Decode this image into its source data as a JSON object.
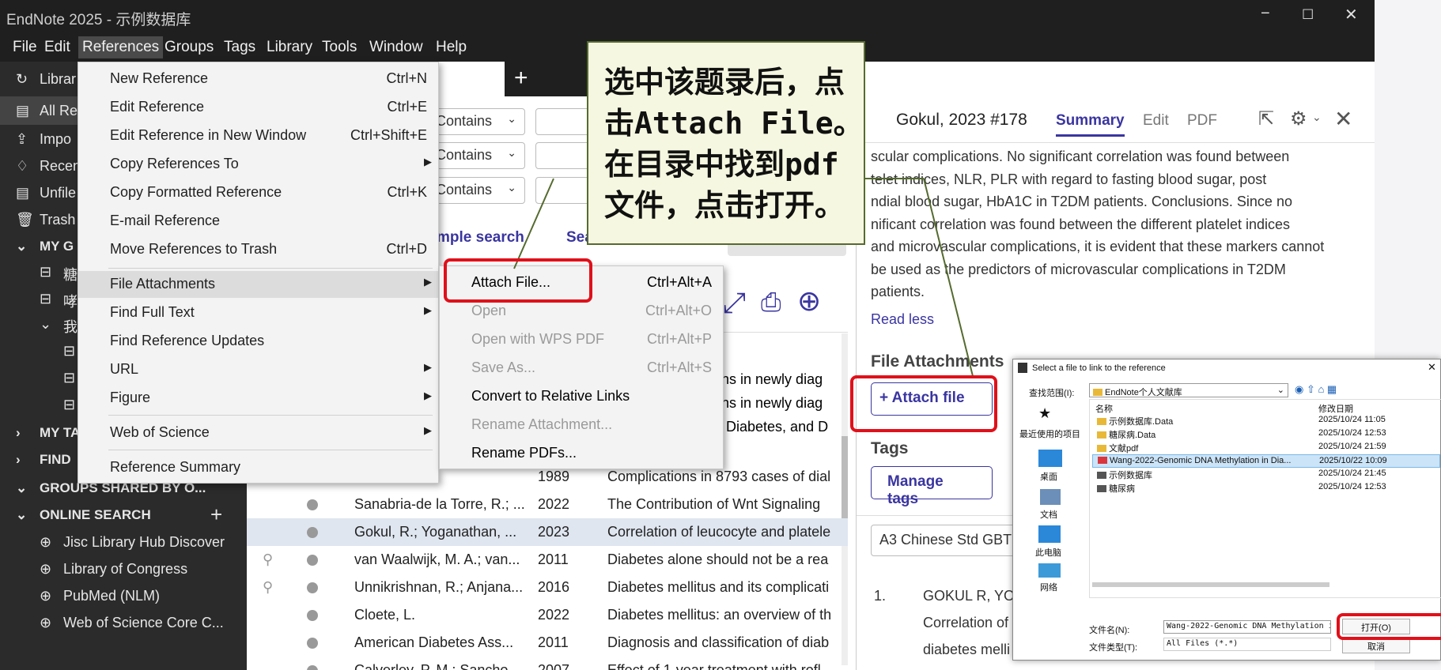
{
  "window": {
    "title": "EndNote 2025 - 示例数据库",
    "min": "−",
    "max": "☐",
    "close": "✕"
  },
  "menubar": [
    "File",
    "Edit",
    "References",
    "Groups",
    "Tags",
    "Library",
    "Tools",
    "Window",
    "Help"
  ],
  "sidebar": {
    "items": [
      "Librar",
      "All Re",
      "Impo",
      "Recen",
      "Unfile",
      "Trash",
      "MY G",
      "糖",
      "哮",
      "我",
      "MY TA",
      "FIND",
      "GROUPS SHARED BY O...",
      "ONLINE SEARCH",
      "Jisc Library Hub Discover",
      "Library of Congress",
      "PubMed (NLM)",
      "Web of Science Core C..."
    ]
  },
  "search": {
    "contains": "Contains",
    "simple": "mple search",
    "sea": "Sea"
  },
  "references_menu": [
    {
      "label": "New Reference",
      "shortcut": "Ctrl+N"
    },
    {
      "label": "Edit Reference",
      "shortcut": "Ctrl+E"
    },
    {
      "label": "Edit Reference in New Window",
      "shortcut": "Ctrl+Shift+E"
    },
    {
      "label": "Copy References To",
      "shortcut": ""
    },
    {
      "label": "Copy Formatted Reference",
      "shortcut": "Ctrl+K"
    },
    {
      "label": "E-mail Reference",
      "shortcut": ""
    },
    {
      "label": "Move References to Trash",
      "shortcut": "Ctrl+D"
    },
    {
      "label": "File Attachments",
      "shortcut": ""
    },
    {
      "label": "Find Full Text",
      "shortcut": ""
    },
    {
      "label": "Find Reference Updates",
      "shortcut": ""
    },
    {
      "label": "URL",
      "shortcut": ""
    },
    {
      "label": "Figure",
      "shortcut": ""
    },
    {
      "label": "Web of Science",
      "shortcut": ""
    },
    {
      "label": "Reference Summary",
      "shortcut": ""
    }
  ],
  "file_submenu": [
    {
      "label": "Attach File...",
      "shortcut": "Ctrl+Alt+A"
    },
    {
      "label": "Open",
      "shortcut": "Ctrl+Alt+O"
    },
    {
      "label": "Open with WPS PDF",
      "shortcut": "Ctrl+Alt+P"
    },
    {
      "label": "Save As...",
      "shortcut": "Ctrl+Alt+S"
    },
    {
      "label": "Convert to Relative Links",
      "shortcut": ""
    },
    {
      "label": "Rename Attachment...",
      "shortcut": ""
    },
    {
      "label": "Rename PDFs...",
      "shortcut": ""
    }
  ],
  "callout": [
    "选中该题录后，点",
    "击Attach File。",
    "在目录中找到pdf",
    "文件，点击打开。"
  ],
  "table": {
    "partial": [
      "ions in newly diag",
      "ions in newly diag",
      "g, Diabetes, and D"
    ],
    "rows": [
      {
        "author": "",
        "year": "1989",
        "title": "Complications in 8793 cases of dial"
      },
      {
        "author": "Sanabria-de la Torre, R.; ...",
        "year": "2022",
        "title": "The Contribution of Wnt Signaling"
      },
      {
        "author": "Gokul, R.; Yoganathan, ...",
        "year": "2023",
        "title": "Correlation of leucocyte and platele"
      },
      {
        "author": "van Waalwijk, M. A.; van...",
        "year": "2011",
        "title": "Diabetes alone should not be a rea"
      },
      {
        "author": "Unnikrishnan, R.; Anjana...",
        "year": "2016",
        "title": "Diabetes mellitus and its complicati"
      },
      {
        "author": "Cloete, L.",
        "year": "2022",
        "title": "Diabetes mellitus: an overview of th"
      },
      {
        "author": "American Diabetes Ass...",
        "year": "2011",
        "title": "Diagnosis and classification of diab"
      },
      {
        "author": "Calverley, P. M.; Sancho...",
        "year": "2007",
        "title": "Effect of 1-year treatment with rofl"
      }
    ]
  },
  "right": {
    "ref": "Gokul, 2023 #178",
    "tabs": [
      "Summary",
      "Edit",
      "PDF"
    ],
    "abstract": [
      "scular complications. No significant correlation was found between",
      "telet indices, NLR, PLR with regard to fasting blood sugar, post",
      "ndial blood sugar, HbA1C in T2DM patients. Conclusions. Since no",
      "nificant correlation was found between the different platelet indices",
      "and microvascular complications, it is evident that these markers cannot",
      "be used as the predictors of microvascular complications in T2DM",
      "patients."
    ],
    "read_less": "Read less",
    "file_attachments": "File Attachments",
    "attach_file": "Attach file",
    "tags": "Tags",
    "manage_tags": "Manage tags",
    "style": "A3 Chinese Std GBT7",
    "cite_num": "1.",
    "cite": [
      "GOKUL R, YOG",
      "Correlation of",
      "diabetes melli"
    ]
  },
  "dialog": {
    "title": "Select a file to link to the reference",
    "lookin_label": "查找范围(I):",
    "lookin": "EndNote个人文献库",
    "col_name": "名称",
    "col_date": "修改日期",
    "places": [
      "最近使用的项目",
      "桌面",
      "文档",
      "此电脑",
      "网络"
    ],
    "files": [
      {
        "name": "示例数据库.Data",
        "date": "2025/10/24 11:05"
      },
      {
        "name": "糖尿病.Data",
        "date": "2025/10/24 12:53"
      },
      {
        "name": "文献pdf",
        "date": "2025/10/24 21:59"
      },
      {
        "name": "Wang-2022-Genomic DNA Methylation in Dia...",
        "date": "2025/10/22 10:09"
      },
      {
        "name": "示例数据库",
        "date": "2025/10/24 21:45"
      },
      {
        "name": "糖尿病",
        "date": "2025/10/24 12:53"
      }
    ],
    "filename_label": "文件名(N):",
    "filename": "Wang-2022-Genomic DNA Methylation in I",
    "filetype_label": "文件类型(T):",
    "filetype": "All Files (*.*)",
    "open": "打开(O)",
    "cancel": "取消"
  },
  "colors": {
    "accent": "#3a35a0",
    "red": "#e0101a",
    "callout_border": "#556b2f"
  }
}
